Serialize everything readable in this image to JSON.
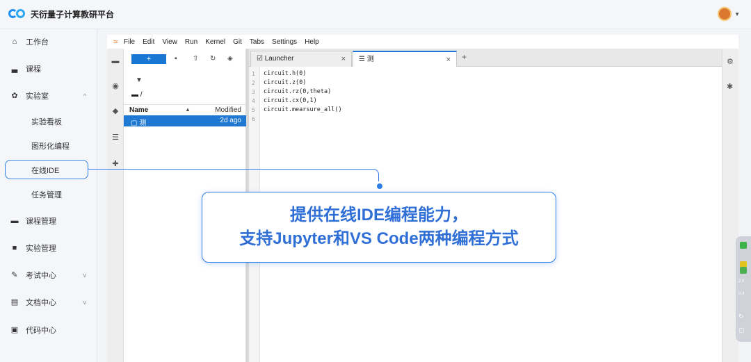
{
  "app": {
    "title": "天衍量子计算教研平台",
    "user_avatar_icon": "avatar-icon"
  },
  "sidebar": {
    "items": [
      {
        "label": "工作台",
        "icon": "home-icon"
      },
      {
        "label": "课程",
        "icon": "chart-icon"
      },
      {
        "label": "实验室",
        "icon": "gear-icon",
        "caret": "^"
      },
      {
        "label": "实验看板"
      },
      {
        "label": "图形化编程"
      },
      {
        "label": "在线IDE"
      },
      {
        "label": "任务管理"
      },
      {
        "label": "课程管理",
        "icon": "folder-icon"
      },
      {
        "label": "实验管理",
        "icon": "book-icon"
      },
      {
        "label": "考试中心",
        "icon": "pen-icon",
        "caret": "v"
      },
      {
        "label": "文档中心",
        "icon": "doc-icon",
        "caret": "v"
      },
      {
        "label": "代码中心",
        "icon": "code-icon"
      }
    ]
  },
  "ide": {
    "menu": [
      "File",
      "Edit",
      "View",
      "Run",
      "Kernel",
      "Git",
      "Tabs",
      "Settings",
      "Help"
    ],
    "filebrowser": {
      "new_label": "+",
      "path": "/",
      "col_name": "Name",
      "col_modified": "Modified",
      "files": [
        {
          "name": "测",
          "modified": "2d ago"
        }
      ]
    },
    "tabs": [
      {
        "label": "Launcher",
        "close": "×"
      },
      {
        "label": "测",
        "close": "×"
      }
    ],
    "tab_add": "+",
    "code_lines": [
      "circuit.h(0)",
      "circuit.z(0)",
      "circuit.rz(0,theta)",
      "circuit.cx(0,1)",
      "circuit.mearsure_all()",
      ""
    ],
    "line_numbers": [
      "1",
      "2",
      "3",
      "4",
      "5",
      "6"
    ]
  },
  "callout": {
    "line1": "提供在线IDE编程能力，",
    "line2": "支持Jupyter和VS Code两种编程方式"
  },
  "monitor": {
    "val1": "2.0",
    "val2": "0.4"
  },
  "colors": {
    "accent": "#2f7de6",
    "jupyter_blue": "#1976d2",
    "jupyter_orange": "#f37726"
  }
}
